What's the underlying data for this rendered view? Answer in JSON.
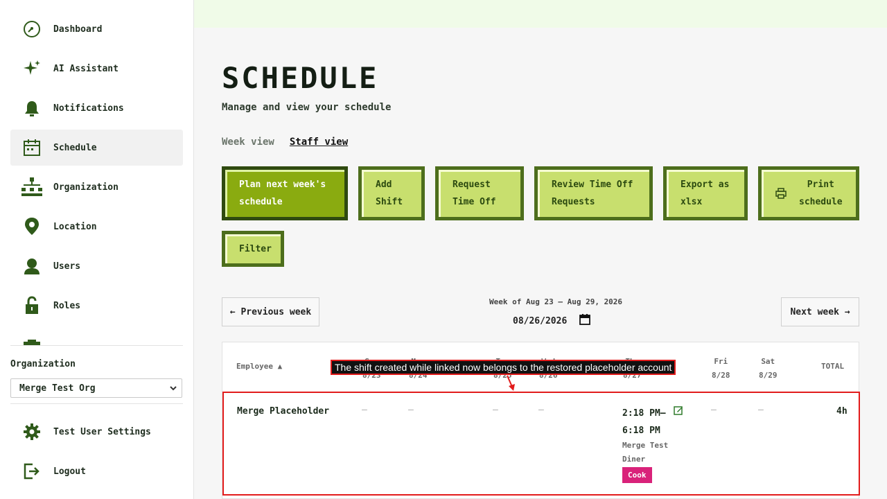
{
  "sidebar": {
    "nav": [
      {
        "label": "Dashboard",
        "icon": "dashboard-icon"
      },
      {
        "label": "AI Assistant",
        "icon": "sparkle-icon"
      },
      {
        "label": "Notifications",
        "icon": "bell-icon"
      },
      {
        "label": "Schedule",
        "icon": "calendar-icon",
        "active": true
      },
      {
        "label": "Organization",
        "icon": "org-chart-icon"
      },
      {
        "label": "Location",
        "icon": "location-pin-icon"
      },
      {
        "label": "Users",
        "icon": "user-icon"
      },
      {
        "label": "Roles",
        "icon": "lock-icon"
      }
    ],
    "organization_label": "Organization",
    "organization_value": "Merge Test Org",
    "footer": [
      {
        "label": "Test User Settings",
        "icon": "gear-icon"
      },
      {
        "label": "Logout",
        "icon": "logout-icon"
      }
    ]
  },
  "main": {
    "title": "SCHEDULE",
    "subtitle": "Manage and view your schedule",
    "tabs": [
      {
        "label": "Week view",
        "active": false
      },
      {
        "label": "Staff view",
        "active": true
      }
    ],
    "actions": [
      {
        "label": "Plan next week's\nschedule"
      },
      {
        "label": "Add\nShift"
      },
      {
        "label": "Request\nTime Off"
      },
      {
        "label": "Review Time Off\nRequests"
      },
      {
        "label": "Export as\nxlsx"
      },
      {
        "label": "Print\nschedule",
        "icon": "printer-icon"
      },
      {
        "label": "Filter"
      }
    ],
    "prev_week": "← Previous week",
    "next_week": "Next week →",
    "week_of": "Week of Aug 23 – Aug 29, 2026",
    "date_value": "08/26/2026"
  },
  "table": {
    "headers": {
      "employee": "Employee ▲",
      "sun_day": "Sun",
      "sun_date": "8/23",
      "mon_day": "Mon",
      "mon_date": "8/24",
      "tue_day": "Tue",
      "tue_date": "8/25",
      "wed_day": "Wed",
      "wed_date": "8/26",
      "thu_day": "Thu",
      "thu_date": "8/27",
      "fri_day": "Fri",
      "fri_date": "8/28",
      "sat_day": "Sat",
      "sat_date": "8/29",
      "total": "TOTAL"
    },
    "row": {
      "employee": "Merge Placeholder",
      "empty": "–",
      "shift_time": "2:18 PM–\n6:18 PM",
      "shift_location": "Merge Test\nDiner",
      "shift_role": "Cook",
      "total": "4h"
    }
  },
  "annotation": {
    "text": "The shift created while linked now belongs to the restored placeholder account"
  },
  "colors": {
    "accent_dark": "#4d6e1c",
    "button_fill": "#c8df6e",
    "primary_fill": "#8aab10",
    "role_badge": "#d9227a",
    "highlight": "#e21b1b"
  }
}
